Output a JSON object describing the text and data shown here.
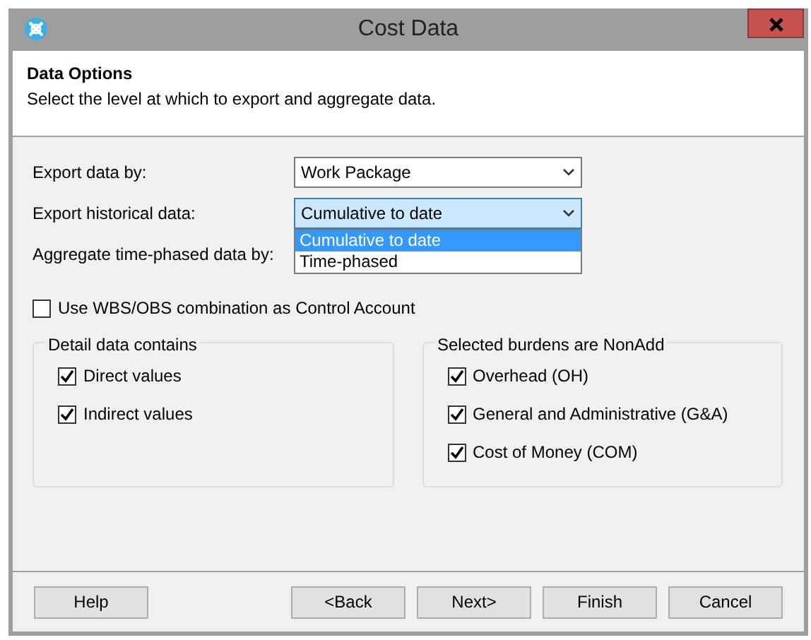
{
  "window": {
    "title": "Cost Data"
  },
  "header": {
    "title": "Data Options",
    "subtitle": "Select the level at which to export and aggregate data."
  },
  "fields": [
    {
      "label": "Export data by:",
      "value": "Work Package",
      "focused": false
    },
    {
      "label": "Export historical data:",
      "value": "Cumulative to date",
      "focused": true,
      "expanded": true,
      "options": [
        {
          "label": "Cumulative to date",
          "selected": true
        },
        {
          "label": "Time-phased",
          "selected": false
        }
      ]
    },
    {
      "label": "Aggregate time-phased data by:"
    }
  ],
  "control_account": {
    "label": "Use WBS/OBS combination as Control Account",
    "checked": false
  },
  "groups": [
    {
      "title": "Detail data contains",
      "items": [
        {
          "label": "Direct values",
          "checked": true
        },
        {
          "label": "Indirect values",
          "checked": true
        }
      ]
    },
    {
      "title": "Selected burdens are NonAdd",
      "items": [
        {
          "label": "Overhead (OH)",
          "checked": true
        },
        {
          "label": "General and Administrative (G&A)",
          "checked": true
        },
        {
          "label": "Cost of Money (COM)",
          "checked": true
        }
      ]
    }
  ],
  "buttons": [
    {
      "label": "Help",
      "kind": "help"
    },
    {
      "label": "<Back",
      "kind": "nav"
    },
    {
      "label": "Next>",
      "kind": "nav"
    },
    {
      "label": "Finish",
      "kind": "nav"
    },
    {
      "label": "Cancel",
      "kind": "nav"
    }
  ]
}
